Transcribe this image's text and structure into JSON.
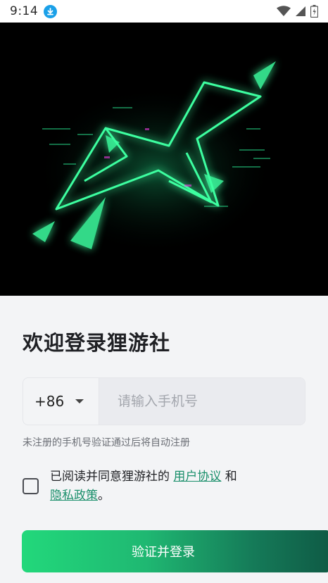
{
  "status_bar": {
    "time": "9:14",
    "icons": [
      "download-icon",
      "wifi-icon",
      "signal-icon",
      "battery-icon"
    ]
  },
  "hero": {
    "accent_color": "#3dffa0"
  },
  "login": {
    "title": "欢迎登录狸游社",
    "country_code": "+86",
    "phone_placeholder": "请输入手机号",
    "hint": "未注册的手机号验证通过后将自动注册",
    "agreement_prefix": "已阅读并同意狸游社的 ",
    "user_agreement": "用户协议",
    "conjunction": " 和",
    "privacy_policy": "隐私政策",
    "agreement_suffix": "。",
    "button_label": "验证并登录",
    "checkbox_checked": false
  },
  "colors": {
    "accent": "#22d87b",
    "link": "#1a8f6b",
    "background": "#f3f4f6"
  }
}
